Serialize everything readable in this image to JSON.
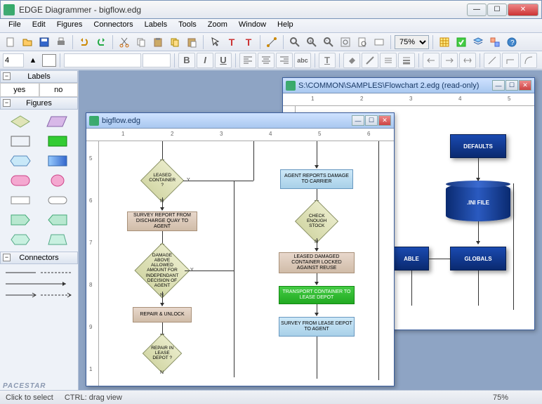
{
  "app": {
    "title": "EDGE Diagrammer - bigflow.edg"
  },
  "menu": [
    "File",
    "Edit",
    "Figures",
    "Connectors",
    "Labels",
    "Tools",
    "Zoom",
    "Window",
    "Help"
  ],
  "zoom": "75%",
  "fontsize_field": "4",
  "panels": {
    "labels": {
      "title": "Labels",
      "yes": "yes",
      "no": "no"
    },
    "figures": {
      "title": "Figures"
    },
    "connectors": {
      "title": "Connectors"
    }
  },
  "docs": {
    "back": {
      "title": "S:\\COMMON\\SAMPLES\\Flowchart 2.edg (read-only)",
      "blocks": {
        "defaults": "DEFAULTS",
        "ini": ".INI FILE",
        "able": "ABLE",
        "globals": "GLOBALS"
      },
      "hruler": [
        "1",
        "2",
        "3",
        "4",
        "5"
      ]
    },
    "front": {
      "title": "bigflow.edg",
      "hruler": [
        "1",
        "2",
        "3",
        "4",
        "5",
        "6"
      ],
      "vruler": [
        "5",
        "6",
        "7",
        "8",
        "9",
        "1"
      ],
      "shapes": {
        "d1": "LEASED CONTAINER ?",
        "p1": "SURVEY REPORT FROM DISCHARGE QUAY TO AGENT",
        "d2": "DAMAGE ABOVE ALLOWED AMOUNT FOR INDEPENDANT DECISION OF AGENT",
        "p2": "REPAIR & UNLOCK",
        "d3": "REPAIR IN LEASE DEPOT ?",
        "p3": "AGENT REPORTS DAMAGE TO CARRIER",
        "d4": "CHECK ENOUGH STOCK",
        "p4": "LEASED DAMAGED CONTAINER LOCKED AGAINST REUSE",
        "p5": "TRANSPORT CONTAINER TO LEASE DEPOT",
        "p6": "SURVEY FROM LEASE DEPOT TO AGENT"
      },
      "edge_y": "Y",
      "edge_n": "N"
    }
  },
  "status": {
    "left1": "Click to select",
    "left2": "CTRL: drag view",
    "right": "75%"
  },
  "brand": "PACESTAR"
}
